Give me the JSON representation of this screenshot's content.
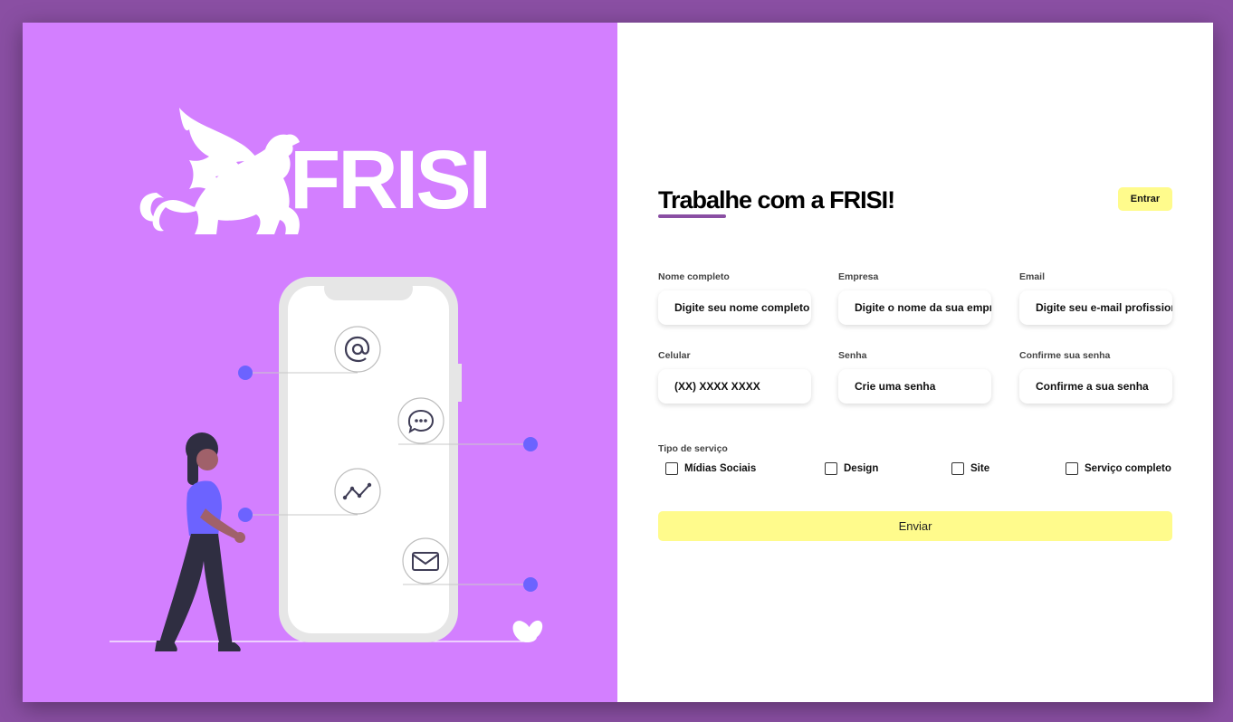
{
  "brand": {
    "name": "FRISI"
  },
  "form": {
    "title": "Trabalhe com a FRISI!",
    "enter_label": "Entrar",
    "fields": [
      {
        "label": "Nome completo",
        "placeholder": "Digite seu nome completo"
      },
      {
        "label": "Empresa",
        "placeholder": "Digite o nome da sua empr"
      },
      {
        "label": "Email",
        "placeholder": "Digite seu e-mail profission"
      },
      {
        "label": "Celular",
        "placeholder": "(XX) XXXX XXXX"
      },
      {
        "label": "Senha",
        "placeholder": "Crie uma senha"
      },
      {
        "label": "Confirme sua senha",
        "placeholder": "Confirme a sua senha"
      }
    ],
    "service_label": "Tipo de serviço",
    "services": [
      "Mídias Sociais",
      "Design",
      "Site",
      "Serviço completo"
    ],
    "submit_label": "Enviar"
  },
  "illustration": {
    "icons": [
      "at-icon",
      "chat-bubble-icon",
      "analytics-icon",
      "envelope-icon"
    ]
  },
  "colors": {
    "page_background": "#8a4fa3",
    "left_panel": "#d37fff",
    "accent_yellow": "#fffb8c",
    "accent_purple": "#8a4fa3",
    "dot_blue": "#6c63ff"
  }
}
